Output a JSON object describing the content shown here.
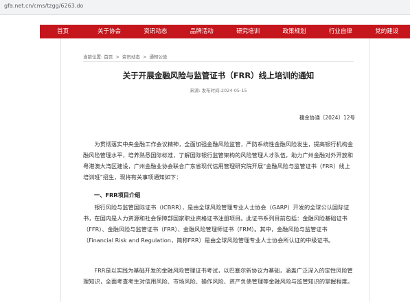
{
  "browser": {
    "url": "gfa.net.cn/cms/tzgg/6263.do"
  },
  "nav": {
    "items": [
      {
        "label": "首页"
      },
      {
        "label": "关于协会"
      },
      {
        "label": "资讯动态"
      },
      {
        "label": "品牌活动"
      },
      {
        "label": "研究培训"
      },
      {
        "label": "政策规划"
      },
      {
        "label": "行业自律"
      },
      {
        "label": "党的建设"
      }
    ]
  },
  "breadcrumb": {
    "prefix": "当前位置:",
    "items": [
      "首页",
      "资讯动态",
      "通知公告"
    ],
    "separator": ">"
  },
  "article": {
    "title": "关于开展金融风险与监管证书（FRR）线上培训的通知",
    "meta": "来源: 发布时间:2024-05-15",
    "doc_number": "穗金协通〔2024〕12号",
    "intro": "为贯彻落实中央金融工作会议精神，全面加强金融风险监管，严防系统性金融风险发生，提高银行机构金融风险管理水平，培养熟悉国际标准，了解国际银行监管架构的风险管理人才队伍，助力广州金融对外开放和粤港澳大湾区建设，广州金融业协会联合广东省现代信用管理研究院开展“金融风险与监管证书（FRR）线上培训班”招生，现将有关事项通知如下：",
    "section1_heading": "一、FRR项目介绍",
    "section1_p1": "银行风险与监管国际证书（ICBRR），是由全球风险管理专业人士协会（GARP）开发的全球公认国际证书，在国内是人力资源和社会保障部国家职业资格证书注册项目。此证书系列目前包括：金融风险基础证书（FFR）、金融风险与监管证书（FRR）、金融风险管理师证书（FRM）。其中，金融风险与监管证书（Financial Risk and Regulation，简称FRR）是由全球风险管理专业人士协会所认证的中级证书。",
    "section1_p2": "FRR是以实践为基础开发的金融风险管理证书考试，以巴塞尔新协议为基础，涵盖广泛深入的定性风险管理知识，全面考查考生对信用风险、市场风险、操作风险、资产负债管理等金融风险与监管知识的掌握程度。"
  }
}
